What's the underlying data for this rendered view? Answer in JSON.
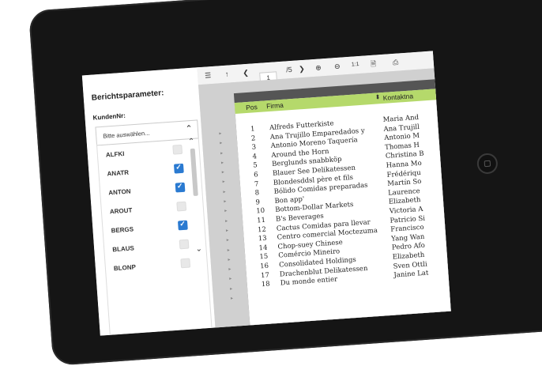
{
  "params": {
    "title": "Berichtsparameter:",
    "field_label": "KundenNr:",
    "placeholder": "Bitte auswählen...",
    "items": [
      {
        "code": "ALFKI",
        "checked": false
      },
      {
        "code": "ANATR",
        "checked": true
      },
      {
        "code": "ANTON",
        "checked": true
      },
      {
        "code": "AROUT",
        "checked": false
      },
      {
        "code": "BERGS",
        "checked": true
      },
      {
        "code": "BLAUS",
        "checked": false
      },
      {
        "code": "BLONP",
        "checked": false
      }
    ]
  },
  "toolbar": {
    "page_value": "1",
    "page_total": "/5",
    "zoom_reset": "1:1"
  },
  "report": {
    "col_pos": "Pos",
    "col_firma": "Firma",
    "col_kontakt": "Kontaktna",
    "rows": [
      {
        "n": "1",
        "firma": "Alfreds Futterkiste",
        "kontakt": "Maria And"
      },
      {
        "n": "2",
        "firma": "Ana Trujillo Emparedados y",
        "kontakt": "Ana Trujill"
      },
      {
        "n": "3",
        "firma": "Antonio Moreno Taquería",
        "kontakt": "Antonio M"
      },
      {
        "n": "4",
        "firma": "Around the Horn",
        "kontakt": "Thomas H"
      },
      {
        "n": "5",
        "firma": "Berglunds snabbköp",
        "kontakt": "Christina B"
      },
      {
        "n": "6",
        "firma": "Blauer See Delikatessen",
        "kontakt": "Hanna Mo"
      },
      {
        "n": "7",
        "firma": "Blondesddsl père et fils",
        "kontakt": "Frédériqu"
      },
      {
        "n": "8",
        "firma": "Bólido Comidas preparadas",
        "kontakt": "Martín So"
      },
      {
        "n": "9",
        "firma": "Bon app'",
        "kontakt": "Laurence"
      },
      {
        "n": "10",
        "firma": "Bottom-Dollar Markets",
        "kontakt": "Elizabeth"
      },
      {
        "n": "11",
        "firma": "B's Beverages",
        "kontakt": "Victoria A"
      },
      {
        "n": "12",
        "firma": "Cactus Comidas para llevar",
        "kontakt": "Patricio Si"
      },
      {
        "n": "13",
        "firma": "Centro comercial Moctezuma",
        "kontakt": "Francisco"
      },
      {
        "n": "14",
        "firma": "Chop-suey Chinese",
        "kontakt": "Yang Wan"
      },
      {
        "n": "15",
        "firma": "Comércio Mineiro",
        "kontakt": "Pedro Afo"
      },
      {
        "n": "16",
        "firma": "Consolidated Holdings",
        "kontakt": "Elizabeth"
      },
      {
        "n": "17",
        "firma": "Drachenblut Delikatessen",
        "kontakt": "Sven Ottli"
      },
      {
        "n": "18",
        "firma": "Du monde entier",
        "kontakt": "Janine Lat"
      }
    ]
  }
}
